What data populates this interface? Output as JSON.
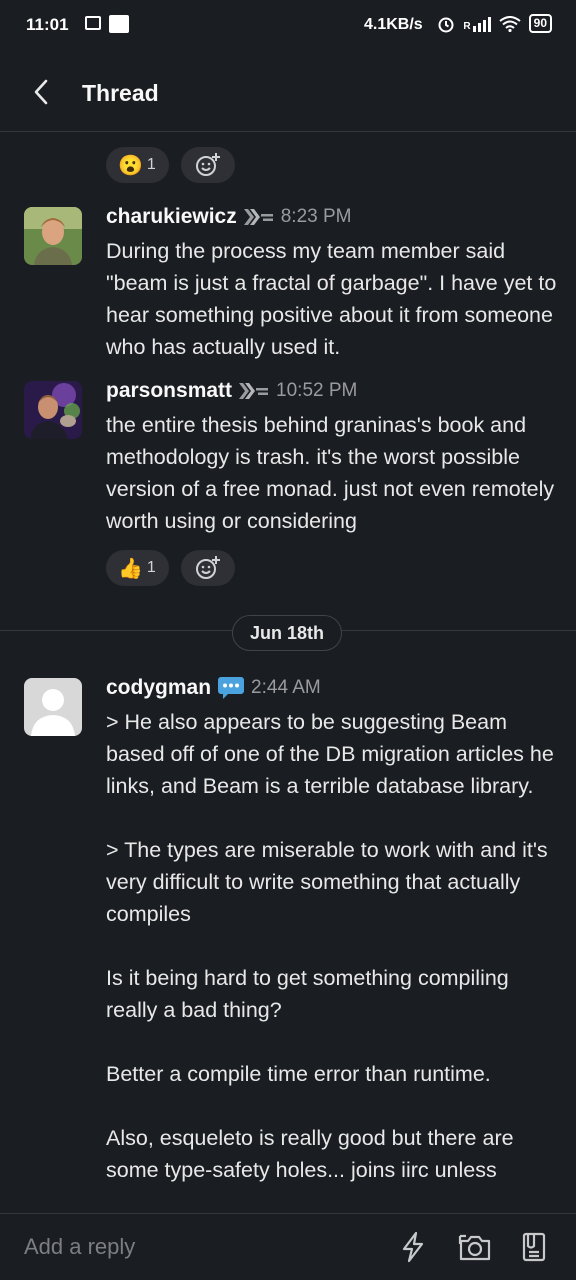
{
  "status_bar": {
    "time": "11:01",
    "speed": "4.1KB/s",
    "signal": "R",
    "battery": "90"
  },
  "header": {
    "title": "Thread"
  },
  "top_reactions": [
    {
      "emoji": "😮",
      "count": "1"
    }
  ],
  "messages": [
    {
      "author": "charukiewicz",
      "time": "8:23 PM",
      "lines": [
        "During the process my team member said \"beam is just a fractal of garbage\". I have yet to hear something positive about it from someone who has actually used it."
      ]
    },
    {
      "author": "parsonsmatt",
      "time": "10:52 PM",
      "lines": [
        "the entire thesis behind graninas's book and methodology is trash. it's the worst possible version of a free monad. just not even remotely worth using or considering"
      ],
      "reactions": [
        {
          "emoji": "👍",
          "count": "1"
        }
      ]
    },
    {
      "author": "codygman",
      "time": "2:44 AM",
      "paragraphs": [
        "> He also appears to be suggesting Beam based off of one of the DB migration articles he links, and Beam is a terrible database library.",
        "> The types are miserable to work with and it's very difficult to write something that actually compiles",
        "Is it being hard to get something compiling really a bad thing?",
        "Better a compile time error than runtime.",
        "Also, esqueleto is really good but there are some type-safety holes... joins iirc unless"
      ]
    }
  ],
  "date_divider": "Jun 18th",
  "composer": {
    "placeholder": "Add a reply"
  },
  "colors": {
    "background": "#1a1d21",
    "text": "#e8e8e8",
    "muted": "#9a9b9e"
  }
}
